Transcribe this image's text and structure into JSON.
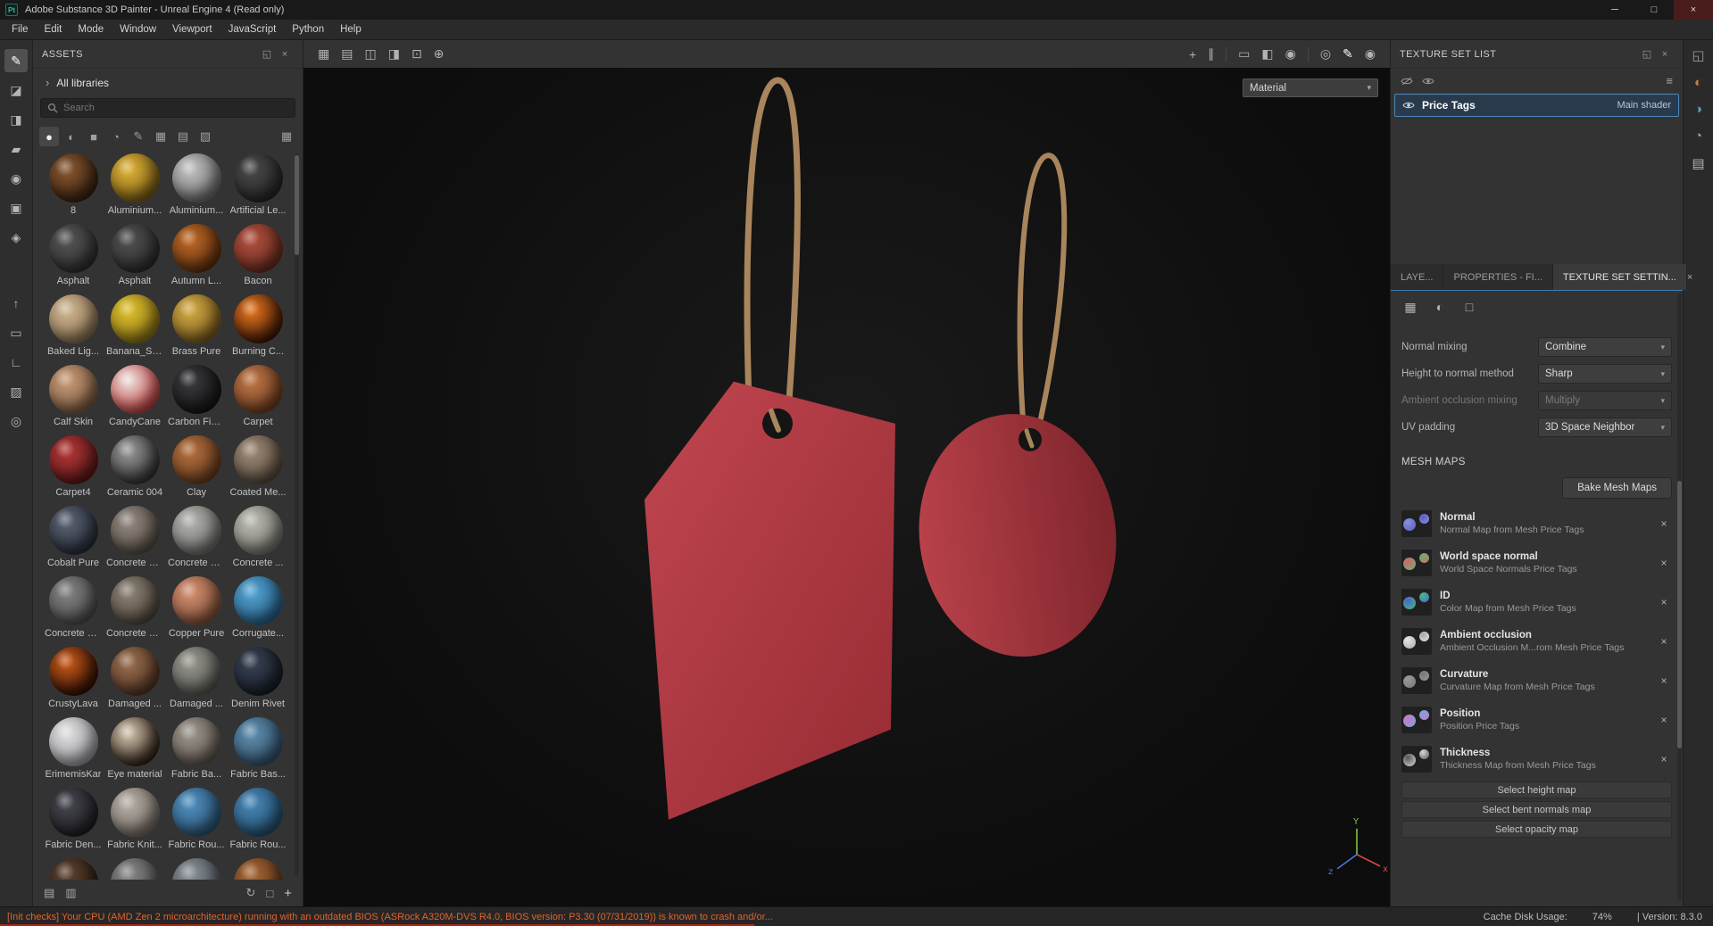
{
  "titlebar": {
    "app_icon_text": "Pt",
    "title": "Adobe Substance 3D Painter - Unreal Engine 4 (Read only)",
    "minimize_glyph": "─",
    "maximize_glyph": "□",
    "close_glyph": "×"
  },
  "menubar": {
    "items": [
      {
        "label": "File"
      },
      {
        "label": "Edit"
      },
      {
        "label": "Mode"
      },
      {
        "label": "Window"
      },
      {
        "label": "Viewport"
      },
      {
        "label": "JavaScript"
      },
      {
        "label": "Python"
      },
      {
        "label": "Help"
      }
    ]
  },
  "toolstrip": {
    "tools": [
      {
        "name": "paint-brush-tool-icon",
        "glyph": "✎",
        "active": true
      },
      {
        "name": "eraser-tool-icon",
        "glyph": "◪"
      },
      {
        "name": "projection-tool-icon",
        "glyph": "◨"
      },
      {
        "name": "polygon-fill-tool-icon",
        "glyph": "▰"
      },
      {
        "name": "smudge-tool-icon",
        "glyph": "◉"
      },
      {
        "name": "clone-tool-icon",
        "glyph": "▣"
      },
      {
        "name": "material-picker-tool-icon",
        "glyph": "◈"
      }
    ],
    "lower": [
      {
        "name": "export-icon",
        "glyph": "↑"
      },
      {
        "name": "display-mode-icon",
        "glyph": "▭"
      },
      {
        "name": "measure-icon",
        "glyph": "∟"
      },
      {
        "name": "stencil-icon",
        "glyph": "▨"
      },
      {
        "name": "quick-mask-icon",
        "glyph": "◎"
      }
    ]
  },
  "assets": {
    "title": "ASSETS",
    "float_glyph": "◱",
    "close_glyph": "×",
    "libraries_chevron": "›",
    "libraries_label": "All libraries",
    "search_placeholder": "Search",
    "filters": [
      {
        "name": "materials-filter-icon",
        "glyph": "●",
        "active": true
      },
      {
        "name": "smart-materials-filter-icon",
        "glyph": "◐"
      },
      {
        "name": "smart-masks-filter-icon",
        "glyph": "■"
      },
      {
        "name": "filters-filter-icon",
        "glyph": "◔"
      },
      {
        "name": "brushes-filter-icon",
        "glyph": "✎"
      },
      {
        "name": "alphas-filter-icon",
        "glyph": "▦"
      },
      {
        "name": "textures-filter-icon",
        "glyph": "▤"
      },
      {
        "name": "environments-filter-icon",
        "glyph": "▨"
      }
    ],
    "view_toggle_glyph": "▦",
    "materials": [
      {
        "name": "8",
        "c1": "#8a5a32",
        "c2": "#38200e"
      },
      {
        "name": "Aluminium...",
        "c1": "#e0b43a",
        "c2": "#7a5c14"
      },
      {
        "name": "Aluminium...",
        "c1": "#c4c4c4",
        "c2": "#6e6e6e"
      },
      {
        "name": "Artificial Le...",
        "c1": "#4a4a4a",
        "c2": "#262626"
      },
      {
        "name": "Asphalt",
        "c1": "#565656",
        "c2": "#2e2e2e"
      },
      {
        "name": "Asphalt",
        "c1": "#525252",
        "c2": "#2c2c2c"
      },
      {
        "name": "Autumn L...",
        "c1": "#c06a28",
        "c2": "#5e2e0c"
      },
      {
        "name": "Bacon",
        "c1": "#b05040",
        "c2": "#6a2c1e"
      },
      {
        "name": "Baked Lig...",
        "c1": "#d0b894",
        "c2": "#8a7050"
      },
      {
        "name": "Banana_Sk...",
        "c1": "#e0c22e",
        "c2": "#8a7214"
      },
      {
        "name": "Brass Pure",
        "c1": "#d4ac46",
        "c2": "#7c5c1c"
      },
      {
        "name": "Burning C...",
        "c1": "#e87820",
        "c2": "#3c1404"
      },
      {
        "name": "Calf Skin",
        "c1": "#c89c78",
        "c2": "#7c5a40"
      },
      {
        "name": "CandyCane",
        "c1": "#ece4e0",
        "c2": "#c23a3a"
      },
      {
        "name": "Carbon Fiber",
        "c1": "#3c3c40",
        "c2": "#141416"
      },
      {
        "name": "Carpet",
        "c1": "#c07848",
        "c2": "#6e3c20"
      },
      {
        "name": "Carpet4",
        "c1": "#b43838",
        "c2": "#5c1616"
      },
      {
        "name": "Ceramic 004",
        "c1": "#9a9a9a",
        "c2": "#303030"
      },
      {
        "name": "Clay",
        "c1": "#b47040",
        "c2": "#6a3c1c"
      },
      {
        "name": "Coated Me...",
        "c1": "#a08c78",
        "c2": "#564a3c"
      },
      {
        "name": "Cobalt Pure",
        "c1": "#5c6474",
        "c2": "#262c38"
      },
      {
        "name": "Concrete B...",
        "c1": "#948a80",
        "c2": "#544c44"
      },
      {
        "name": "Concrete C...",
        "c1": "#b4b4b0",
        "c2": "#6e6e6a"
      },
      {
        "name": "Concrete ...",
        "c1": "#bcbcb4",
        "c2": "#76766e"
      },
      {
        "name": "Concrete S...",
        "c1": "#848484",
        "c2": "#4a4a4a"
      },
      {
        "name": "Concrete S...",
        "c1": "#8e8478",
        "c2": "#4e463c"
      },
      {
        "name": "Copper Pure",
        "c1": "#d49070",
        "c2": "#84503a"
      },
      {
        "name": "Corrugate...",
        "c1": "#54a4d4",
        "c2": "#266086"
      },
      {
        "name": "CrustyLava",
        "c1": "#cc5c1a",
        "c2": "#2e0e04"
      },
      {
        "name": "Damaged ...",
        "c1": "#9a7050",
        "c2": "#523424"
      },
      {
        "name": "Damaged ...",
        "c1": "#9a9a90",
        "c2": "#545450"
      },
      {
        "name": "Denim Rivet",
        "c1": "#3a4456",
        "c2": "#161c26"
      },
      {
        "name": "ErimemisKar",
        "c1": "#e0e0e0",
        "c2": "#9a9aa0"
      },
      {
        "name": "Eye material",
        "c1": "#d8c8b4",
        "c2": "#2a1c10"
      },
      {
        "name": "Fabric Ba...",
        "c1": "#a09890",
        "c2": "#5c544c"
      },
      {
        "name": "Fabric Bas...",
        "c1": "#6090b0",
        "c2": "#32506a"
      },
      {
        "name": "Fabric Den...",
        "c1": "#484850",
        "c2": "#1e1e24"
      },
      {
        "name": "Fabric Knit...",
        "c1": "#b8b0a8",
        "c2": "#746c64"
      },
      {
        "name": "Fabric Rou...",
        "c1": "#5090c0",
        "c2": "#2a5474"
      },
      {
        "name": "Fabric Rou...",
        "c1": "#4888b8",
        "c2": "#24506e"
      },
      {
        "name": "",
        "c1": "#5e4432",
        "c2": "#281a10"
      },
      {
        "name": "",
        "c1": "#888888",
        "c2": "#4c4c4c"
      },
      {
        "name": "",
        "c1": "#8a9098",
        "c2": "#4c5258"
      },
      {
        "name": "",
        "c1": "#a86838",
        "c2": "#5c3418"
      }
    ],
    "footer": {
      "list_view_glyph": "▤",
      "details_view_glyph": "▥",
      "refresh_glyph": "↻",
      "frame_glyph": "□",
      "add_glyph": "+"
    }
  },
  "toolbar": {
    "left": [
      {
        "name": "tiling-icon",
        "glyph": "▦"
      },
      {
        "name": "tiling-mode-icon",
        "glyph": "▤"
      },
      {
        "name": "symmetry-icon",
        "glyph": "◫"
      },
      {
        "name": "symmetry-plane-icon",
        "glyph": "◨"
      },
      {
        "name": "frame-view-icon",
        "glyph": "⊡"
      },
      {
        "name": "navigation-icon",
        "glyph": "⊕"
      }
    ],
    "group_view": [
      {
        "name": "focus-view-icon",
        "glyph": "+"
      },
      {
        "name": "pause-engine-icon",
        "glyph": "∥"
      }
    ],
    "group_display": [
      {
        "name": "viewport-layout-icon",
        "glyph": "▭"
      },
      {
        "name": "material-shading-icon",
        "glyph": "◧"
      },
      {
        "name": "camera-icon",
        "glyph": "◉"
      }
    ],
    "group_paint": [
      {
        "name": "color-picker-icon",
        "glyph": "◎"
      },
      {
        "name": "paint-tool-icon",
        "glyph": "✎",
        "active": true
      },
      {
        "name": "snapshot-icon",
        "glyph": "◉"
      }
    ]
  },
  "viewport": {
    "shader_dropdown_value": "Material",
    "chevron": "▾",
    "gizmo": {
      "x_label": "x",
      "y_label": "Y",
      "z_label": "z"
    }
  },
  "scene": {
    "tag1a": "#c14650",
    "tag1b": "#962b33",
    "tag2a": "#b8414a",
    "tag2b": "#7f252c",
    "string": "#a8855c",
    "hole": "#141414",
    "axis_x": "#e04545",
    "axis_y": "#7ec43f",
    "axis_z": "#4a77e0"
  },
  "texture_set_list": {
    "title": "TEXTURE SET LIST",
    "float_glyph": "◱",
    "close_glyph": "×",
    "filter_glyph": "≡",
    "item": {
      "name": "Price Tags",
      "shader": "Main shader"
    }
  },
  "tabs": {
    "items": [
      {
        "label": "LAYE..."
      },
      {
        "label": "PROPERTIES - FI..."
      },
      {
        "label": "TEXTURE SET SETTIN..."
      }
    ],
    "close_glyph": "×"
  },
  "texture_set_settings": {
    "panel_icons": [
      {
        "name": "channels-icon",
        "glyph": "▦"
      },
      {
        "name": "material-sphere-icon",
        "glyph": "◐"
      },
      {
        "name": "uv-icon",
        "glyph": "□"
      }
    ],
    "chevron": "▾",
    "rows": [
      {
        "label": "Normal mixing",
        "value": "Combine",
        "disabled": false
      },
      {
        "label": "Height to normal method",
        "value": "Sharp",
        "disabled": false
      },
      {
        "label": "Ambient occlusion mixing",
        "value": "Multiply",
        "disabled": true
      },
      {
        "label": "UV padding",
        "value": "3D Space Neighbor",
        "disabled": false
      }
    ],
    "mesh_maps_title": "MESH MAPS",
    "bake_button": "Bake Mesh Maps",
    "remove_glyph": "×",
    "maps": [
      {
        "name": "Normal",
        "desc": "Normal Map from Mesh Price Tags",
        "c1": "#8a8ede",
        "c2": "#5a5ec0"
      },
      {
        "name": "World space normal",
        "desc": "World Space Normals Price Tags",
        "c1": "#d06868",
        "c2": "#68b078"
      },
      {
        "name": "ID",
        "desc": "Color Map from Mesh Price Tags",
        "c1": "#4868c8",
        "c2": "#48b888"
      },
      {
        "name": "Ambient occlusion",
        "desc": "Ambient Occlusion M...rom Mesh Price Tags",
        "c1": "#e6e6e6",
        "c2": "#a8a8a8"
      },
      {
        "name": "Curvature",
        "desc": "Curvature Map from Mesh Price Tags",
        "c1": "#9a9a9a",
        "c2": "#787878"
      },
      {
        "name": "Position",
        "desc": "Position Price Tags",
        "c1": "#c878c8",
        "c2": "#78a8d8"
      },
      {
        "name": "Thickness",
        "desc": "Thickness Map from Mesh Price Tags",
        "c1": "#585858",
        "c2": "#d8d8d8"
      }
    ],
    "select_buttons": [
      {
        "label": "Select height map"
      },
      {
        "label": "Select bent normals map"
      },
      {
        "label": "Select opacity map"
      }
    ]
  },
  "rightstrip": {
    "icons": [
      {
        "name": "dock-panel-icon",
        "glyph": "◱",
        "color": "#9a9a9a"
      },
      {
        "name": "display-settings-icon",
        "glyph": "◐",
        "color": "#c08040"
      },
      {
        "name": "shader-settings-icon",
        "glyph": "◑",
        "color": "#58a0b0"
      },
      {
        "name": "history-icon",
        "glyph": "◔",
        "color": "#a0a0a0"
      },
      {
        "name": "log-icon",
        "glyph": "▤",
        "color": "#b4b4b4"
      }
    ]
  },
  "statusbar": {
    "warning": "[Init checks] Your CPU (AMD Zen 2 microarchitecture) running with an outdated BIOS (ASRock A320M-DVS R4.0, BIOS version: P3.30 (07/31/2019)) is known to crash and/or...",
    "cache_label": "Cache Disk Usage:",
    "cache_value": "74%",
    "version": "| Version: 8.3.0"
  }
}
